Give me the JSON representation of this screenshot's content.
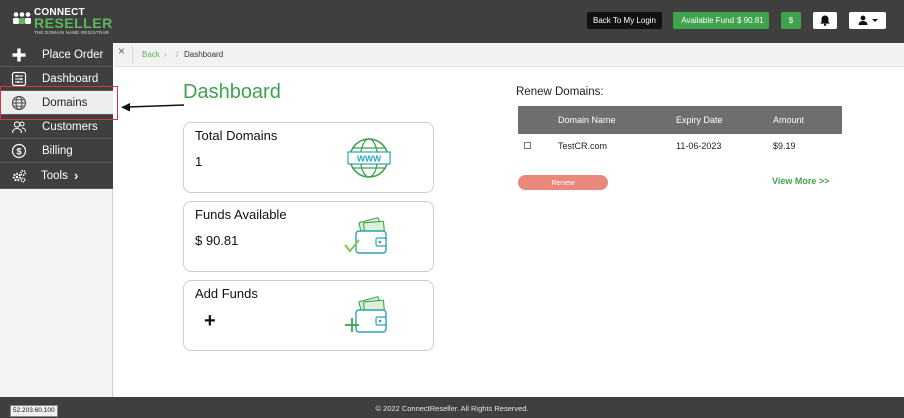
{
  "brand": {
    "line1": "CONNECT",
    "line2": "RESELLER",
    "tagline": "THE DOMAIN NAME REGISTRAR"
  },
  "topbar": {
    "back_to_login": "Back To My Login",
    "available_fund_label": "Available Fund",
    "available_fund_value": "$ 90.81",
    "dollar_button": "$"
  },
  "sidebar": {
    "items": [
      {
        "label": "Place Order",
        "icon": "plus-icon"
      },
      {
        "label": "Dashboard",
        "icon": "dashboard-icon"
      },
      {
        "label": "Domains",
        "icon": "globe-icon"
      },
      {
        "label": "Customers",
        "icon": "customers-icon"
      },
      {
        "label": "Billing",
        "icon": "billing-icon"
      },
      {
        "label": "Tools",
        "icon": "gears-icon"
      }
    ],
    "tools_chevron": "›"
  },
  "breadcrumb": {
    "close": "×",
    "back": "Back",
    "arrow": "›",
    "slash": "/",
    "current": "Dashboard"
  },
  "main": {
    "title": "Dashboard",
    "cards": [
      {
        "title": "Total Domains",
        "value": "1",
        "icon": "www-globe-icon"
      },
      {
        "title": "Funds Available",
        "value": "$ 90.81",
        "icon": "wallet-check-icon"
      },
      {
        "title": "Add Funds",
        "value": "+",
        "icon": "wallet-plus-icon"
      }
    ]
  },
  "renew": {
    "title": "Renew Domains:",
    "columns": [
      "Domain Name",
      "Expiry Date",
      "Amount"
    ],
    "rows": [
      {
        "domain": "TestCR.com",
        "expiry": "11-06-2023",
        "amount": "$9.19"
      }
    ],
    "renew_button": "Renew",
    "view_more": "View More >>"
  },
  "footer": {
    "ip": "52.203.60.100",
    "copyright": "© 2022 ConnectReseller. All Rights Reserved."
  },
  "colors": {
    "accent_green": "#3fa34d",
    "dark_bar": "#3f3f3f",
    "renew_button": "#e8897c",
    "annotation_red": "#d9363e"
  }
}
